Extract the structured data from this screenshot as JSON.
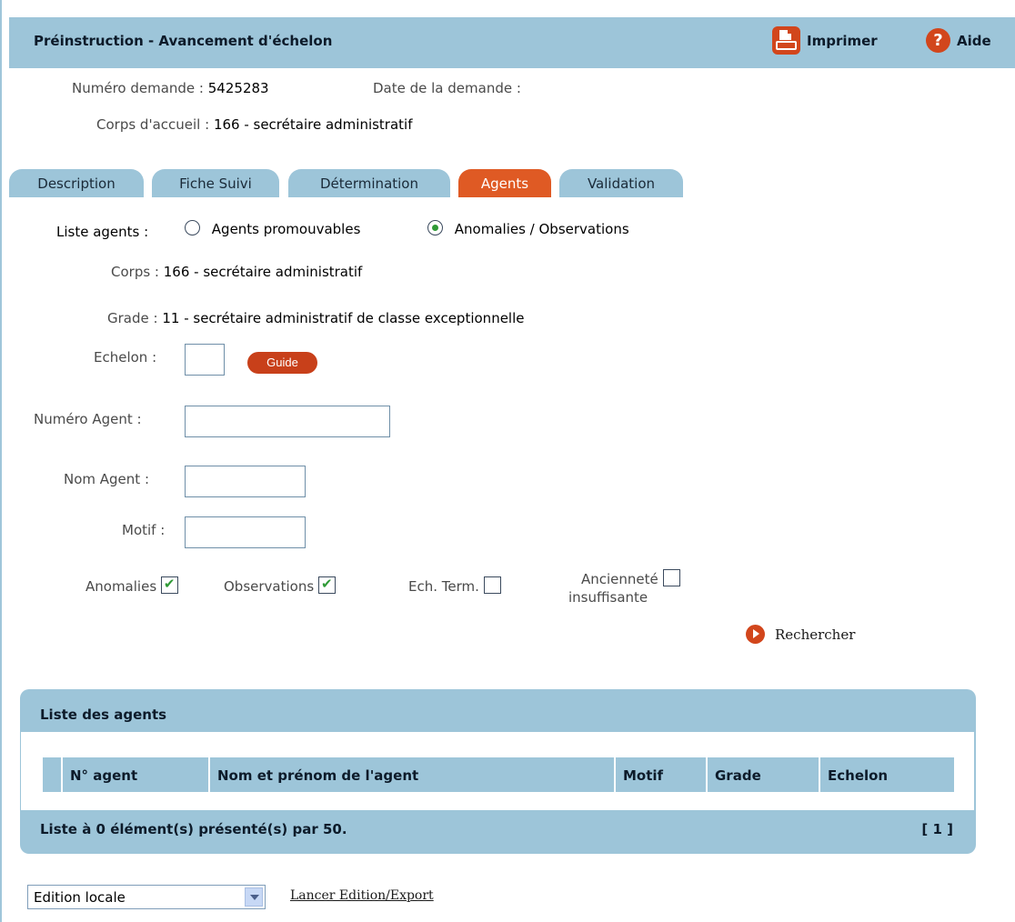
{
  "header": {
    "title": "Préinstruction - Avancement d'échelon",
    "print_label": "Imprimer",
    "help_label": "Aide"
  },
  "request": {
    "number_label": "Numéro demande :",
    "number_value": "5425283",
    "date_label": "Date de la demande :",
    "date_value": "",
    "corps_label": "Corps d'accueil :",
    "corps_value": "166 - secrétaire administratif"
  },
  "tabs": [
    {
      "label": "Description",
      "active": false
    },
    {
      "label": "Fiche Suivi",
      "active": false
    },
    {
      "label": "Détermination",
      "active": false
    },
    {
      "label": "Agents",
      "active": true
    },
    {
      "label": "Validation",
      "active": false
    }
  ],
  "form": {
    "list_label": "Liste agents :",
    "radio_promouvables": {
      "label": "Agents promouvables",
      "checked": false
    },
    "radio_anomalies": {
      "label": "Anomalies / Observations",
      "checked": true
    },
    "corps_label": "Corps :",
    "corps_value": "166 - secrétaire administratif",
    "grade_label": "Grade :",
    "grade_value": "11 - secrétaire administratif de classe exceptionnelle",
    "echelon_label": "Echelon :",
    "echelon_value": "",
    "guide_label": "Guide",
    "numero_agent_label": "Numéro Agent :",
    "numero_agent_value": "",
    "nom_agent_label": "Nom Agent :",
    "nom_agent_value": "",
    "motif_label": "Motif :",
    "motif_value": "",
    "check_anomalies": {
      "label": "Anomalies",
      "checked": true
    },
    "check_observations": {
      "label": "Observations",
      "checked": true
    },
    "check_ech_term": {
      "label": "Ech. Term.",
      "checked": false
    },
    "check_anciennete": {
      "label_line1": "Ancienneté",
      "label_line2": "insuffisante",
      "checked": false
    },
    "search_label": "Rechercher"
  },
  "agents_list": {
    "title": "Liste des agents",
    "columns": [
      "N° agent",
      "Nom et prénom de l'agent",
      "Motif",
      "Grade",
      "Echelon"
    ],
    "rows": [],
    "footer": "Liste à 0 élément(s) présenté(s) par 50.",
    "pages": "[ 1 ]"
  },
  "export": {
    "selected": "Edition locale",
    "launch_label": "Lancer Edition/Export"
  },
  "colors": {
    "header_bg": "#9dc5d9",
    "accent": "#df5a24",
    "check_green": "#2f9a36"
  }
}
